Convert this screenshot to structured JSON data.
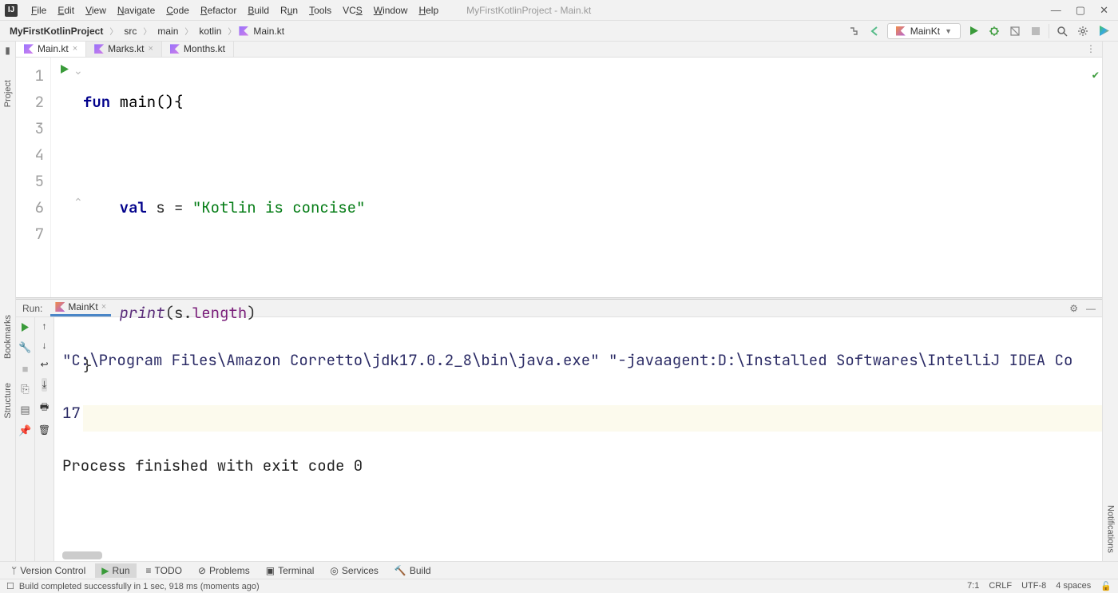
{
  "window": {
    "title": "MyFirstKotlinProject - Main.kt"
  },
  "menu": [
    "File",
    "Edit",
    "View",
    "Navigate",
    "Code",
    "Refactor",
    "Build",
    "Run",
    "Tools",
    "VCS",
    "Window",
    "Help"
  ],
  "breadcrumbs": {
    "project": "MyFirstKotlinProject",
    "parts": [
      "src",
      "main",
      "kotlin",
      "Main.kt"
    ]
  },
  "runConfig": "MainKt",
  "tabs": [
    {
      "name": "Main.kt",
      "active": true
    },
    {
      "name": "Marks.kt",
      "active": false
    },
    {
      "name": "Months.kt",
      "active": false
    }
  ],
  "code": {
    "lines": {
      "l1a": "fun",
      "l1b": " main(){",
      "l3a": "    ",
      "l3b": "val",
      "l3c": " s = ",
      "l3d": "\"Kotlin is concise\"",
      "l5a": "    ",
      "l5b": "print",
      "l5c": "(s.",
      "l5d": "length",
      "l5e": ")",
      "l6": "}"
    },
    "gutter": [
      "1",
      "2",
      "3",
      "4",
      "5",
      "6",
      "7"
    ]
  },
  "runPanel": {
    "label": "Run:",
    "tab": "MainKt",
    "out1": "\"C:\\Program Files\\Amazon Corretto\\jdk17.0.2_8\\bin\\java.exe\" \"-javaagent:D:\\Installed Softwares\\IntelliJ IDEA Co",
    "out2": "17",
    "out3": "Process finished with exit code 0"
  },
  "bottomTools": [
    "Version Control",
    "Run",
    "TODO",
    "Problems",
    "Terminal",
    "Services",
    "Build"
  ],
  "sideTools": {
    "project": "Project",
    "bookmarks": "Bookmarks",
    "structure": "Structure",
    "notifications": "Notifications"
  },
  "status": {
    "msg": "Build completed successfully in 1 sec, 918 ms (moments ago)",
    "pos": "7:1",
    "sep": "CRLF",
    "enc": "UTF-8",
    "indent": "4 spaces"
  }
}
